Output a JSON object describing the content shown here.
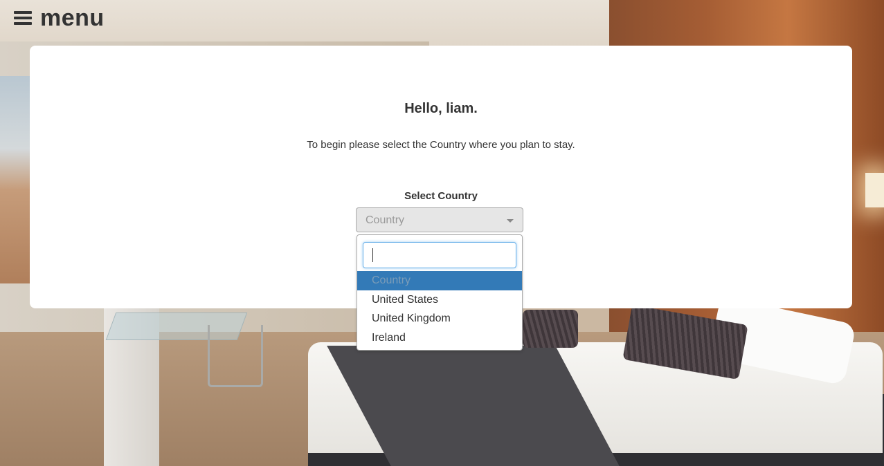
{
  "menu": {
    "label": "menu",
    "icon": "hamburger-icon"
  },
  "card": {
    "greeting": "Hello, liam.",
    "instruction": "To begin please select the Country where you plan to stay.",
    "select_label": "Select Country"
  },
  "country_select": {
    "value": "Country",
    "arrow_icon": "caret-down-icon",
    "search_value": "",
    "options": [
      {
        "label": "Country",
        "highlighted": true
      },
      {
        "label": "United States",
        "highlighted": false
      },
      {
        "label": "United Kingdom",
        "highlighted": false
      },
      {
        "label": "Ireland",
        "highlighted": false
      }
    ]
  },
  "colors": {
    "highlight": "#337ab7",
    "focus_border": "#66afe9",
    "text": "#333333",
    "card_bg": "#ffffff"
  }
}
